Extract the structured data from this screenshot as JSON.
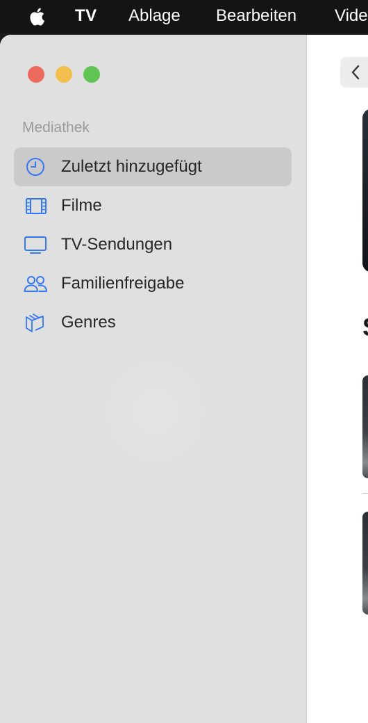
{
  "menubar": {
    "apple_icon": "apple-icon",
    "app_name": "TV",
    "items": [
      "Ablage",
      "Bearbeiten",
      "Vide"
    ]
  },
  "sidebar": {
    "section_label": "Mediathek",
    "items": [
      {
        "label": "Zuletzt hinzugefügt",
        "icon": "clock-icon",
        "selected": true
      },
      {
        "label": "Filme",
        "icon": "film-icon",
        "selected": false
      },
      {
        "label": "TV-Sendungen",
        "icon": "tv-icon",
        "selected": false
      },
      {
        "label": "Familienfreigabe",
        "icon": "people-icon",
        "selected": false
      },
      {
        "label": "Genres",
        "icon": "genres-icon",
        "selected": false
      }
    ]
  },
  "content": {
    "back_icon": "chevron-left-icon",
    "section_heading": "S"
  },
  "colors": {
    "accent": "#3478f6",
    "sidebar_bg": "#e0e0e0",
    "selected_bg": "#cacaca",
    "menubar_bg": "#161412"
  }
}
